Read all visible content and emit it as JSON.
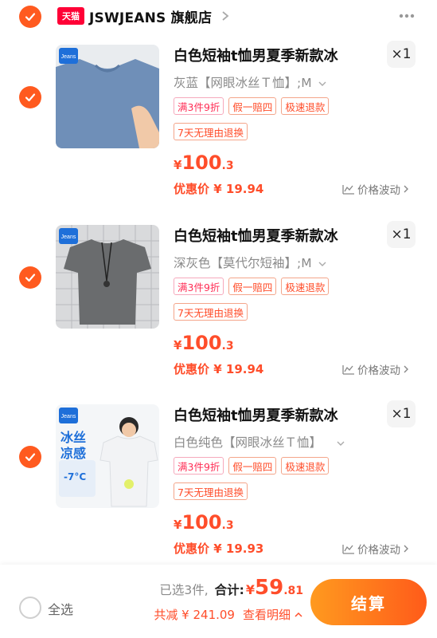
{
  "shop": {
    "badge": "天猫",
    "name": "JSWJEANS 旗舰店"
  },
  "items": [
    {
      "title": "白色短袖t恤男夏季新款冰",
      "qty": "×1",
      "sku": "灰蓝【网眼冰丝Ｔ恤】;M",
      "tags": [
        "满3件9折",
        "假一赔四",
        "极速退款",
        "7天无理由退换"
      ],
      "price_yen": "¥",
      "price_int": "100",
      "price_dec": ".3",
      "promo": "优惠价 ¥ 19.94",
      "trend": "价格波动",
      "shirt_color": "#6f8fb8"
    },
    {
      "title": "白色短袖t恤男夏季新款冰",
      "qty": "×1",
      "sku": "深灰色【莫代尔短袖】;M",
      "tags": [
        "满3件9折",
        "假一赔四",
        "极速退款",
        "7天无理由退换"
      ],
      "price_yen": "¥",
      "price_int": "100",
      "price_dec": ".3",
      "promo": "优惠价 ¥ 19.94",
      "trend": "价格波动",
      "shirt_color": "#6a6c6e"
    },
    {
      "title": "白色短袖t恤男夏季新款冰",
      "qty": "×1",
      "sku": "白色纯色【网眼冰丝Ｔ恤】",
      "tags": [
        "满3件9折",
        "假一赔四",
        "极速退款",
        "7天无理由退换"
      ],
      "price_yen": "¥",
      "price_int": "100",
      "price_dec": ".3",
      "promo": "优惠价 ¥ 19.93",
      "trend": "价格波动",
      "shirt_color": "#f2f3f5",
      "thumb_text": [
        "冰丝",
        "凉感",
        "-7°C"
      ]
    }
  ],
  "footer": {
    "select_all": "全选",
    "selected_count": "已选3件,",
    "total_label": "合计:",
    "total_yen": "¥",
    "total_int": "59",
    "total_dec": ".81",
    "discount": "共减 ¥ 241.09",
    "detail": "查看明细",
    "checkout": "结算"
  },
  "colors": {
    "accent": "#ff5a1f",
    "price": "#ff4d2a",
    "tmall": "#ff0036"
  },
  "icons": [
    "check-icon",
    "chevron-right-icon",
    "more-dots-icon",
    "chart-icon",
    "chevron-up-icon",
    "chevron-down-icon"
  ]
}
